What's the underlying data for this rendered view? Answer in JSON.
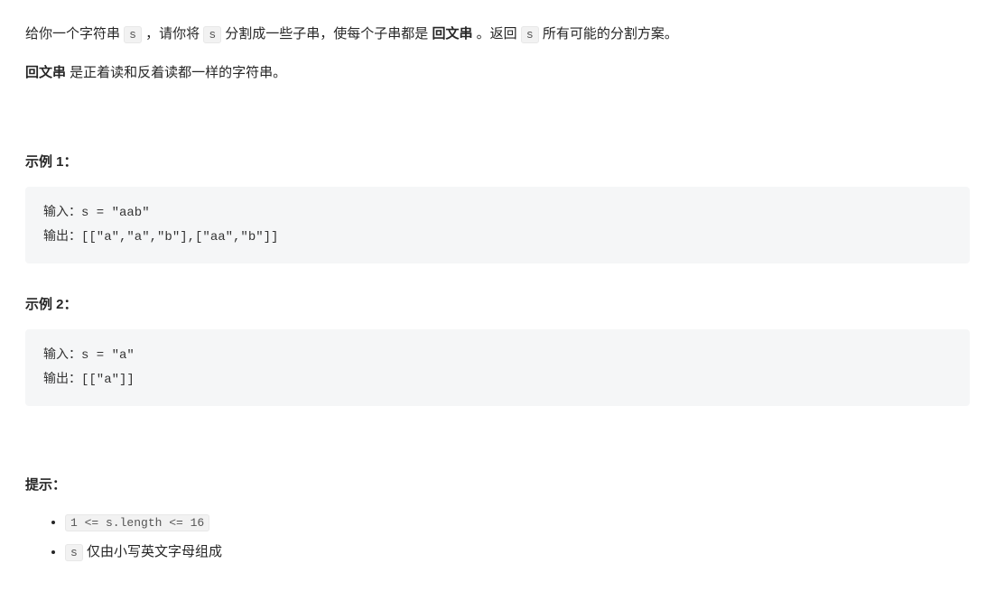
{
  "intro": {
    "part1": "给你一个字符串 ",
    "code_s1": "s",
    "part2": " ，请你将 ",
    "code_s2": "s",
    "part3": " 分割成一些子串，使每个子串都是 ",
    "bold_palindrome": "回文串",
    "part4": " 。返回 ",
    "code_s3": "s",
    "part5": " 所有可能的分割方案。"
  },
  "definition": {
    "bold": "回文串",
    "text": " 是正着读和反着读都一样的字符串。"
  },
  "examples": {
    "heading1": "示例 1：",
    "block1": "输入：s = \"aab\"\n输出：[[\"a\",\"a\",\"b\"],[\"aa\",\"b\"]]",
    "heading2": "示例 2：",
    "block2": "输入：s = \"a\"\n输出：[[\"a\"]]"
  },
  "constraints": {
    "heading": "提示：",
    "items": [
      {
        "code": "1 <= s.length <= 16",
        "tail": ""
      },
      {
        "code": "s",
        "tail": " 仅由小写英文字母组成"
      }
    ]
  }
}
